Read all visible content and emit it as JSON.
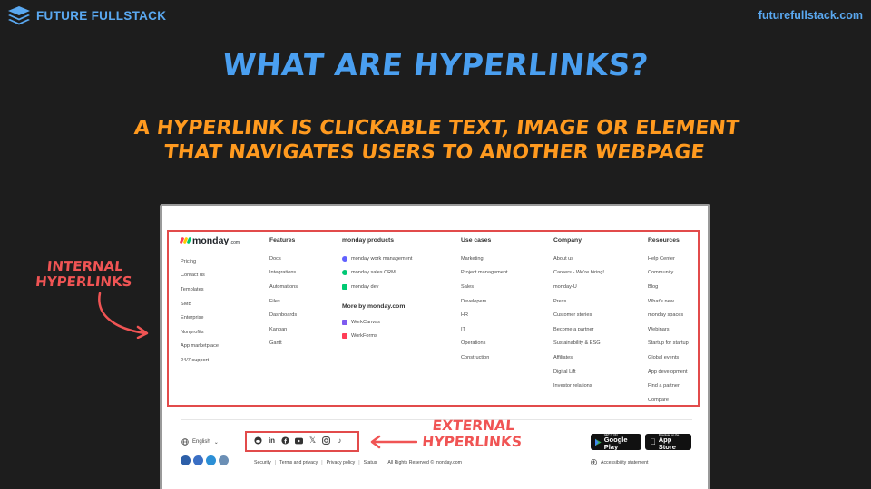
{
  "header": {
    "brand": "FUTURE FULLSTACK",
    "site_url": "futurefullstack.com",
    "logo_icon": "layers-icon",
    "accent_color": "#5aa8f0"
  },
  "slide": {
    "title": "WHAT ARE HYPERLINKS?",
    "subtitle_line1": "A HYPERLINK IS CLICKABLE TEXT, IMAGE OR ELEMENT",
    "subtitle_line2": "THAT NAVIGATES USERS TO ANOTHER WEBPAGE",
    "title_color": "#4a9ff0",
    "subtitle_color": "#ff9a1f"
  },
  "annotations": {
    "internal": "INTERNAL HYPERLINKS",
    "external": "EXTERNAL HYPERLINKS",
    "color": "#f05454"
  },
  "footer": {
    "logo_word": "monday",
    "logo_suffix": ".com",
    "columns": [
      {
        "heading": "",
        "items": [
          "Pricing",
          "Contact us",
          "Templates",
          "SMB",
          "Enterprise",
          "Nonprofits",
          "App marketplace",
          "24/7 support"
        ]
      },
      {
        "heading": "Features",
        "items": [
          "Docs",
          "Integrations",
          "Automations",
          "Files",
          "Dashboards",
          "Kanban",
          "Gantt"
        ]
      },
      {
        "heading": "monday products",
        "items": [
          "monday work management",
          "monday sales CRM",
          "monday dev"
        ],
        "subheading": "More by monday.com",
        "subitems": [
          "WorkCanvas",
          "WorkForms"
        ]
      },
      {
        "heading": "Use cases",
        "items": [
          "Marketing",
          "Project management",
          "Sales",
          "Developers",
          "HR",
          "IT",
          "Operations",
          "Construction"
        ]
      },
      {
        "heading": "Company",
        "items": [
          "About us",
          "Careers - We're hiring!",
          "monday-U",
          "Press",
          "Customer stories",
          "Become a partner",
          "Sustainability & ESG",
          "Affiliates",
          "Digital Lift",
          "Investor relations"
        ]
      },
      {
        "heading": "Resources",
        "items": [
          "Help Center",
          "Community",
          "Blog",
          "What's new",
          "monday spaces",
          "Webinars",
          "Startup for startup",
          "Global events",
          "App development",
          "Find a partner",
          "Compare"
        ]
      }
    ],
    "language": "English",
    "social_icons": [
      "reddit-icon",
      "linkedin-icon",
      "facebook-icon",
      "youtube-icon",
      "x-icon",
      "instagram-icon",
      "tiktok-icon"
    ],
    "stores": {
      "google_small": "GET IT ON",
      "google_big": "Google Play",
      "apple_small": "Download on the",
      "apple_big": "App Store"
    },
    "bottom_links": [
      "Security",
      "Terms and privacy",
      "Privacy policy",
      "Status"
    ],
    "rights": "All Rights Reserved © monday.com",
    "accessibility": "Accessibility statement"
  }
}
